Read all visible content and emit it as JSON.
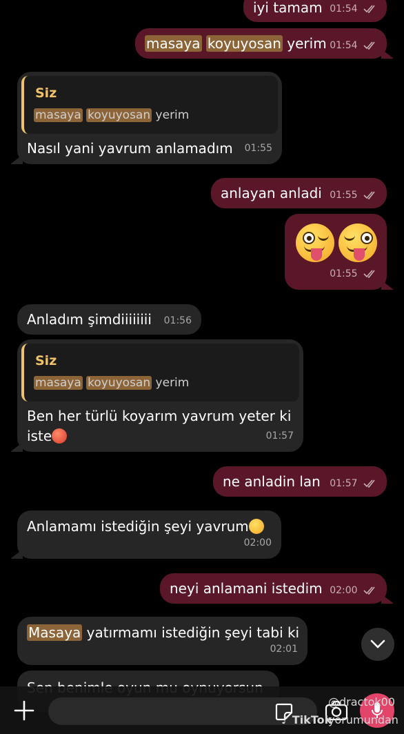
{
  "messages": [
    {
      "text": "iyi tamam",
      "time": "01:54"
    },
    {
      "text_prefix_1": "masaya",
      "text_prefix_2": "koyuyosan",
      "text_suffix": "yerim",
      "time": "01:54"
    },
    {
      "reply_author": "Siz",
      "reply_hl_1": "masaya",
      "reply_hl_2": "koyuyosan",
      "reply_rest": "yerim",
      "text": "Nasıl yani yavrum anlamadım",
      "time": "01:55"
    },
    {
      "text": "anlayan anladi",
      "time": "01:55"
    },
    {
      "emoji_1": "winking-tongue-emoji",
      "emoji_2": "winking-tongue-emoji",
      "time": "01:55"
    },
    {
      "text": "Anladım şimdiiiiiiii",
      "time": "01:56"
    },
    {
      "reply_author": "Siz",
      "reply_hl_1": "masaya",
      "reply_hl_2": "koyuyosan",
      "reply_rest": "yerim",
      "line_1": "Ben her türlü koyarım yavrum yeter ki",
      "line_2": "iste",
      "time": "01:57"
    },
    {
      "text": "ne anladin lan",
      "time": "01:57"
    },
    {
      "text": "Anlamamı istediğin şeyi yavrum",
      "time": "02:00"
    },
    {
      "text": "neyi anlamani istedim",
      "time": "02:00"
    },
    {
      "hl": "Masaya",
      "rest": " yatırmamı istediğin şeyi tabi ki",
      "time": "02:01"
    },
    {
      "text": "Sen benimle oyun mu oynuyorsun"
    }
  ],
  "watermark": {
    "handle": "@dractok00",
    "brand": "TikTok",
    "suffix": "yorumundan"
  },
  "colors": {
    "outgoing": "#5a1727",
    "incoming": "#262626",
    "highlight": "#8c6438",
    "reply_accent": "#f0c36a"
  },
  "icons": [
    "read-check-icon",
    "chevron-down-icon",
    "plus-icon",
    "sticker-icon",
    "camera-icon",
    "microphone-icon"
  ]
}
